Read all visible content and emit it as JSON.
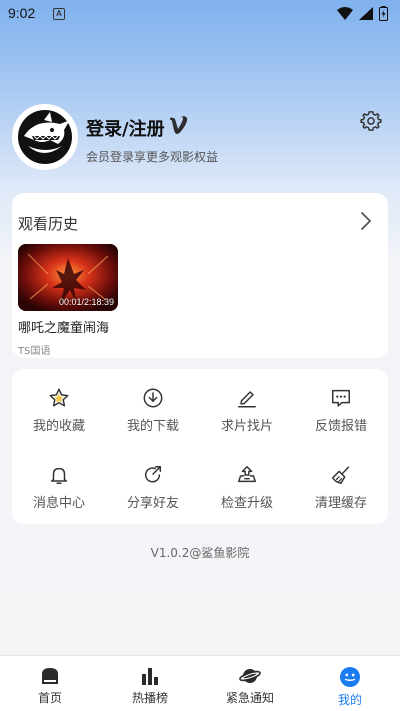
{
  "status_bar": {
    "time": "9:02",
    "notif_letter": "A"
  },
  "profile": {
    "login_label": "登录/注册",
    "subtitle": "会员登录享更多观影权益"
  },
  "history": {
    "title": "观看历史",
    "items": [
      {
        "title": "哪吒之魔童闹海",
        "progress": "00:01/2:18:39",
        "tag": "TS国语"
      }
    ]
  },
  "functions": [
    {
      "label": "我的收藏",
      "icon": "star-icon"
    },
    {
      "label": "我的下载",
      "icon": "download-icon"
    },
    {
      "label": "求片找片",
      "icon": "pen-icon"
    },
    {
      "label": "反馈报错",
      "icon": "message-icon"
    },
    {
      "label": "消息中心",
      "icon": "bell-icon"
    },
    {
      "label": "分享好友",
      "icon": "share-icon"
    },
    {
      "label": "检查升级",
      "icon": "upgrade-icon"
    },
    {
      "label": "清理缓存",
      "icon": "broom-icon"
    }
  ],
  "version": "V1.0.2@鲨鱼影院",
  "nav": [
    {
      "label": "首页",
      "icon": "home-icon"
    },
    {
      "label": "热播榜",
      "icon": "chart-icon"
    },
    {
      "label": "紧急通知",
      "icon": "planet-icon"
    },
    {
      "label": "我的",
      "icon": "face-icon",
      "active": true
    }
  ],
  "colors": {
    "accent": "#1a7cf0",
    "text": "#222222",
    "muted": "#888888"
  }
}
